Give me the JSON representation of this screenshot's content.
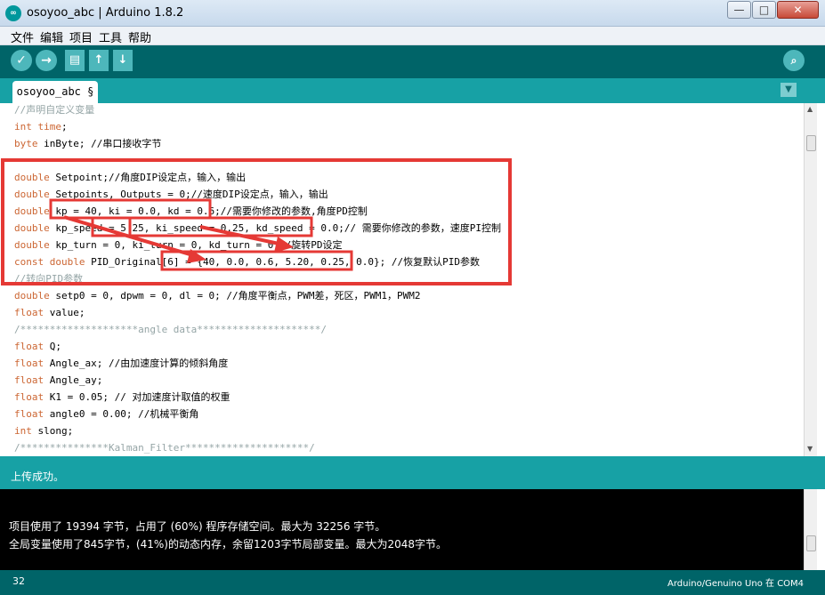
{
  "window": {
    "title": "osoyoo_abc | Arduino 1.8.2",
    "logo_text": "∞",
    "minimize": "—",
    "maximize": "□",
    "close": "✕"
  },
  "menu": [
    "文件",
    "编辑",
    "项目",
    "工具",
    "帮助"
  ],
  "toolbar": {
    "verify": "✓",
    "upload": "→",
    "new": "▤",
    "open": "↑",
    "save": "↓",
    "serial_monitor": "⌕"
  },
  "tab": {
    "name": "osoyoo_abc §",
    "menu_arrow": "▼"
  },
  "code": [
    [
      {
        "t": "//声明自定义变量",
        "c": "cm"
      }
    ],
    [
      {
        "t": "int",
        "c": "kw"
      },
      {
        "t": " "
      },
      {
        "t": "time",
        "c": "kw"
      },
      {
        "t": ";"
      }
    ],
    [
      {
        "t": "byte",
        "c": "kw"
      },
      {
        "t": " inByte; //串口接收字节"
      }
    ],
    [
      {
        "t": ""
      }
    ],
    [
      {
        "t": "double",
        "c": "kw"
      },
      {
        "t": " Setpoint;//角度DIP设定点，输入，输出"
      }
    ],
    [
      {
        "t": "double",
        "c": "kw"
      },
      {
        "t": " Setpoints, Outputs = 0;//速度DIP设定点，输入，输出"
      }
    ],
    [
      {
        "t": "double",
        "c": "kw"
      },
      {
        "t": " kp = 40, ki = 0.0, kd = 0.6;//需要你修改的参数,角度PD控制"
      }
    ],
    [
      {
        "t": "double",
        "c": "kw"
      },
      {
        "t": " kp_speed = 5.25, ki_speed = 0.25, kd_speed = 0.0;// 需要你修改的参数，速度PI控制"
      }
    ],
    [
      {
        "t": "double",
        "c": "kw"
      },
      {
        "t": " kp_turn = 0, ki_turn = 0, kd_turn = 0;//旋转PD设定"
      }
    ],
    [
      {
        "t": "const",
        "c": "kw"
      },
      {
        "t": " "
      },
      {
        "t": "double",
        "c": "kw"
      },
      {
        "t": " PID_Original[6] = {40, 0.0, 0.6, 5.20, 0.25, 0.0}; //恢复默认PID参数"
      }
    ],
    [
      {
        "t": "//转向PID参数",
        "c": "cm"
      }
    ],
    [
      {
        "t": "double",
        "c": "kw"
      },
      {
        "t": " setp0 = 0, dpwm = 0, dl = 0; //角度平衡点，PWM差，死区，PWM1，PWM2"
      }
    ],
    [
      {
        "t": "float",
        "c": "kw"
      },
      {
        "t": " value;"
      }
    ],
    [
      {
        "t": "/********************angle data*********************/",
        "c": "cm"
      }
    ],
    [
      {
        "t": "float",
        "c": "kw"
      },
      {
        "t": " Q;"
      }
    ],
    [
      {
        "t": "float",
        "c": "kw"
      },
      {
        "t": " Angle_ax; //由加速度计算的倾斜角度"
      }
    ],
    [
      {
        "t": "float",
        "c": "kw"
      },
      {
        "t": " Angle_ay;"
      }
    ],
    [
      {
        "t": "float",
        "c": "kw"
      },
      {
        "t": " K1 = 0.05; // 对加速度计取值的权重"
      }
    ],
    [
      {
        "t": "float",
        "c": "kw"
      },
      {
        "t": " angle0 = 0.00; //机械平衡角"
      }
    ],
    [
      {
        "t": "int",
        "c": "kw"
      },
      {
        "t": " slong;"
      }
    ],
    [
      {
        "t": "/***************Kalman_Filter*********************/",
        "c": "cm"
      }
    ]
  ],
  "status": {
    "message": "上传成功。"
  },
  "console": [
    "项目使用了 19394 字节，占用了 (60%) 程序存储空间。最大为 32256 字节。",
    "全局变量使用了845字节，(41%)的动态内存，余留1203字节局部变量。最大为2048字节。"
  ],
  "footer": {
    "line": "32",
    "board": "Arduino/Genuino Uno 在 COM4"
  },
  "colors": {
    "teal_dark": "#006468",
    "teal": "#17a1a5",
    "keyword": "#cc6633",
    "comment": "#95a5a6",
    "annotation_red": "#e53935"
  }
}
